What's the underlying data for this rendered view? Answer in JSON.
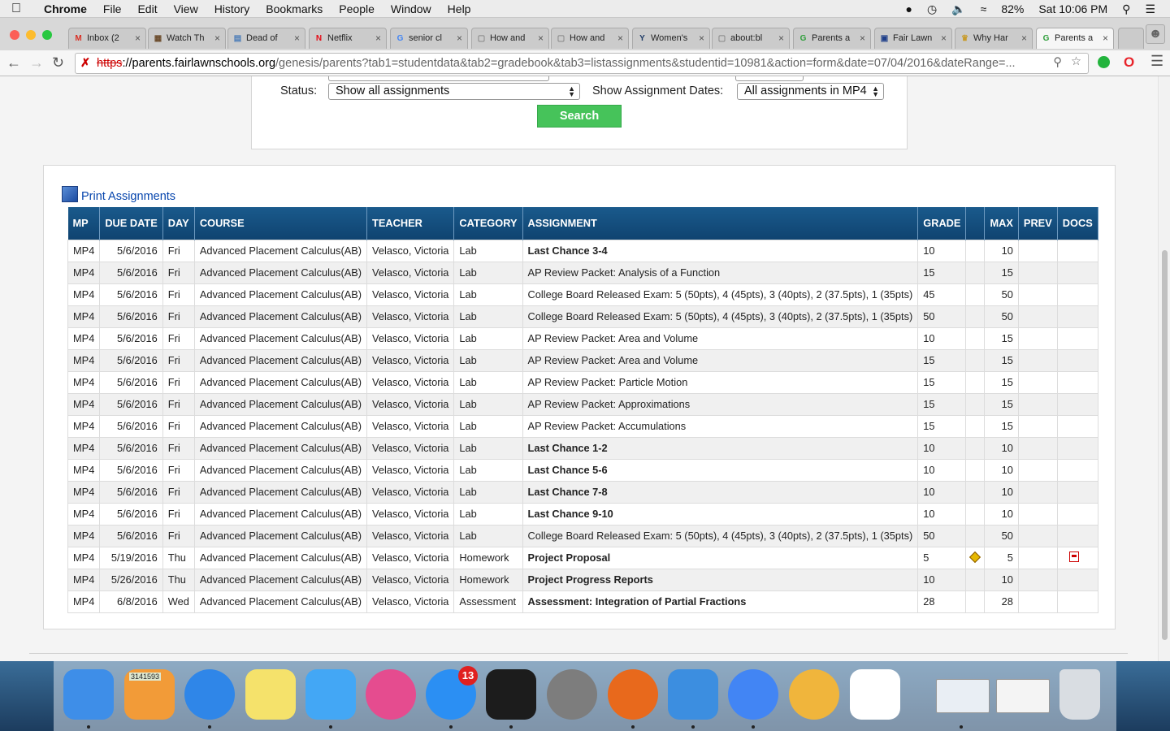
{
  "menubar": {
    "app": "Chrome",
    "items": [
      "File",
      "Edit",
      "View",
      "History",
      "Bookmarks",
      "People",
      "Window",
      "Help"
    ],
    "battery": "82%",
    "clock": "Sat 10:06 PM"
  },
  "tabs": [
    {
      "label": "Inbox (2",
      "icon": "gmail-icon",
      "color": "#d93025",
      "fav": "M"
    },
    {
      "label": "Watch Th",
      "icon": "film-icon",
      "color": "#6a4a2a",
      "fav": "▦"
    },
    {
      "label": "Dead of",
      "icon": "page-icon",
      "color": "#4a7bb7",
      "fav": "▤"
    },
    {
      "label": "Netflix",
      "icon": "netflix-icon",
      "color": "#e50914",
      "fav": "N"
    },
    {
      "label": "senior cl",
      "icon": "google-icon",
      "color": "#4285f4",
      "fav": "G"
    },
    {
      "label": "How and",
      "icon": "document-icon",
      "color": "#888888",
      "fav": "▢"
    },
    {
      "label": "How and",
      "icon": "document-icon",
      "color": "#888888",
      "fav": "▢"
    },
    {
      "label": "Women's",
      "icon": "bird-icon",
      "color": "#1d3a66",
      "fav": "Y"
    },
    {
      "label": "about:bl",
      "icon": "document-icon",
      "color": "#888888",
      "fav": "▢"
    },
    {
      "label": "Parents a",
      "icon": "genesis-icon",
      "color": "#2e9e3a",
      "fav": "G"
    },
    {
      "label": "Fair Lawn",
      "icon": "school-icon",
      "color": "#1f3f8a",
      "fav": "▣"
    },
    {
      "label": "Why Har",
      "icon": "crown-icon",
      "color": "#c89b2a",
      "fav": "♛"
    },
    {
      "label": "Parents a",
      "icon": "genesis-icon",
      "color": "#2e9e3a",
      "fav": "G",
      "active": true
    }
  ],
  "address": {
    "scheme": "https",
    "host": "://parents.fairlawnschools.org",
    "path": "/genesis/parents?tab1=studentdata&tab2=gradebook&tab3=listassignments&studentid=10981&action=form&date=07/04/2016&dateRange=..."
  },
  "filters": {
    "status_label": "Status:",
    "status_value": "Show all assignments",
    "dates_label": "Show Assignment Dates:",
    "dates_value": "All assignments in MP4",
    "search_label": "Search"
  },
  "print_link": "Print Assignments",
  "table": {
    "headers": [
      "MP",
      "DUE DATE",
      "DAY",
      "COURSE",
      "TEACHER",
      "CATEGORY",
      "ASSIGNMENT",
      "GRADE",
      "",
      "MAX",
      "PREV",
      "DOCS"
    ],
    "rows": [
      {
        "mp": "MP4",
        "due": "5/6/2016",
        "day": "Fri",
        "course": "Advanced Placement Calculus(AB)",
        "teacher": "Velasco, Victoria",
        "category": "Lab",
        "assignment": "Last Chance 3-4",
        "bold": true,
        "grade": "10",
        "max": "10"
      },
      {
        "mp": "MP4",
        "due": "5/6/2016",
        "day": "Fri",
        "course": "Advanced Placement Calculus(AB)",
        "teacher": "Velasco, Victoria",
        "category": "Lab",
        "assignment": "AP Review Packet: Analysis of a Function",
        "bold": false,
        "grade": "15",
        "max": "15"
      },
      {
        "mp": "MP4",
        "due": "5/6/2016",
        "day": "Fri",
        "course": "Advanced Placement Calculus(AB)",
        "teacher": "Velasco, Victoria",
        "category": "Lab",
        "assignment": "College Board Released Exam: 5 (50pts), 4 (45pts), 3 (40pts), 2 (37.5pts), 1 (35pts)",
        "bold": false,
        "grade": "45",
        "max": "50"
      },
      {
        "mp": "MP4",
        "due": "5/6/2016",
        "day": "Fri",
        "course": "Advanced Placement Calculus(AB)",
        "teacher": "Velasco, Victoria",
        "category": "Lab",
        "assignment": "College Board Released Exam: 5 (50pts), 4 (45pts), 3 (40pts), 2 (37.5pts), 1 (35pts)",
        "bold": false,
        "grade": "50",
        "max": "50"
      },
      {
        "mp": "MP4",
        "due": "5/6/2016",
        "day": "Fri",
        "course": "Advanced Placement Calculus(AB)",
        "teacher": "Velasco, Victoria",
        "category": "Lab",
        "assignment": "AP Review Packet: Area and Volume",
        "bold": false,
        "grade": "10",
        "max": "15"
      },
      {
        "mp": "MP4",
        "due": "5/6/2016",
        "day": "Fri",
        "course": "Advanced Placement Calculus(AB)",
        "teacher": "Velasco, Victoria",
        "category": "Lab",
        "assignment": "AP Review Packet: Area and Volume",
        "bold": false,
        "grade": "15",
        "max": "15"
      },
      {
        "mp": "MP4",
        "due": "5/6/2016",
        "day": "Fri",
        "course": "Advanced Placement Calculus(AB)",
        "teacher": "Velasco, Victoria",
        "category": "Lab",
        "assignment": "AP Review Packet: Particle Motion",
        "bold": false,
        "grade": "15",
        "max": "15"
      },
      {
        "mp": "MP4",
        "due": "5/6/2016",
        "day": "Fri",
        "course": "Advanced Placement Calculus(AB)",
        "teacher": "Velasco, Victoria",
        "category": "Lab",
        "assignment": "AP Review Packet: Approximations",
        "bold": false,
        "grade": "15",
        "max": "15"
      },
      {
        "mp": "MP4",
        "due": "5/6/2016",
        "day": "Fri",
        "course": "Advanced Placement Calculus(AB)",
        "teacher": "Velasco, Victoria",
        "category": "Lab",
        "assignment": "AP Review Packet: Accumulations",
        "bold": false,
        "grade": "15",
        "max": "15"
      },
      {
        "mp": "MP4",
        "due": "5/6/2016",
        "day": "Fri",
        "course": "Advanced Placement Calculus(AB)",
        "teacher": "Velasco, Victoria",
        "category": "Lab",
        "assignment": "Last Chance 1-2",
        "bold": true,
        "grade": "10",
        "max": "10"
      },
      {
        "mp": "MP4",
        "due": "5/6/2016",
        "day": "Fri",
        "course": "Advanced Placement Calculus(AB)",
        "teacher": "Velasco, Victoria",
        "category": "Lab",
        "assignment": "Last Chance 5-6",
        "bold": true,
        "grade": "10",
        "max": "10"
      },
      {
        "mp": "MP4",
        "due": "5/6/2016",
        "day": "Fri",
        "course": "Advanced Placement Calculus(AB)",
        "teacher": "Velasco, Victoria",
        "category": "Lab",
        "assignment": "Last Chance 7-8",
        "bold": true,
        "grade": "10",
        "max": "10"
      },
      {
        "mp": "MP4",
        "due": "5/6/2016",
        "day": "Fri",
        "course": "Advanced Placement Calculus(AB)",
        "teacher": "Velasco, Victoria",
        "category": "Lab",
        "assignment": "Last Chance 9-10",
        "bold": true,
        "grade": "10",
        "max": "10"
      },
      {
        "mp": "MP4",
        "due": "5/6/2016",
        "day": "Fri",
        "course": "Advanced Placement Calculus(AB)",
        "teacher": "Velasco, Victoria",
        "category": "Lab",
        "assignment": "College Board Released Exam: 5 (50pts), 4 (45pts), 3 (40pts), 2 (37.5pts), 1 (35pts)",
        "bold": false,
        "grade": "50",
        "max": "50"
      },
      {
        "mp": "MP4",
        "due": "5/19/2016",
        "day": "Thu",
        "course": "Advanced Placement Calculus(AB)",
        "teacher": "Velasco, Victoria",
        "category": "Homework",
        "assignment": "Project Proposal",
        "bold": true,
        "grade": "5",
        "max": "5",
        "comment_icon": "pencil-icon",
        "doc_icon": "pdf-icon"
      },
      {
        "mp": "MP4",
        "due": "5/26/2016",
        "day": "Thu",
        "course": "Advanced Placement Calculus(AB)",
        "teacher": "Velasco, Victoria",
        "category": "Homework",
        "assignment": "Project Progress Reports",
        "bold": true,
        "grade": "10",
        "max": "10"
      },
      {
        "mp": "MP4",
        "due": "6/8/2016",
        "day": "Wed",
        "course": "Advanced Placement Calculus(AB)",
        "teacher": "Velasco, Victoria",
        "category": "Assessment",
        "assignment": "Assessment: Integration of Partial Fractions",
        "bold": true,
        "grade": "28",
        "max": "28"
      }
    ]
  },
  "dock": {
    "apps": [
      {
        "name": "finder-icon",
        "color": "#3e8ee8"
      },
      {
        "name": "calculator-icon",
        "color": "#f29b38",
        "label": "3141593"
      },
      {
        "name": "safari-icon",
        "color": "#2f86e8"
      },
      {
        "name": "notes-icon",
        "color": "#f5e26b"
      },
      {
        "name": "messages-icon",
        "color": "#43a7f5"
      },
      {
        "name": "itunes-icon",
        "color": "#e54c8f"
      },
      {
        "name": "app-store-icon",
        "color": "#2b8ff3",
        "badge": "13"
      },
      {
        "name": "activity-monitor-icon",
        "color": "#1c1c1c"
      },
      {
        "name": "system-preferences-icon",
        "color": "#7d7d7d"
      },
      {
        "name": "firefox-icon",
        "color": "#e8691c"
      },
      {
        "name": "word-icon",
        "color": "#3c8ee0"
      },
      {
        "name": "chrome-icon",
        "color": "#4285f4"
      },
      {
        "name": "photos-icon",
        "color": "#f0b53c"
      },
      {
        "name": "podcast-app-icon",
        "color": "#ffffff"
      },
      {
        "name": "window-thumbnail-1",
        "color": "#e9eef4"
      },
      {
        "name": "window-thumbnail-2",
        "color": "#f4f4f4"
      },
      {
        "name": "trash-icon",
        "color": "#d9dde2"
      }
    ]
  }
}
